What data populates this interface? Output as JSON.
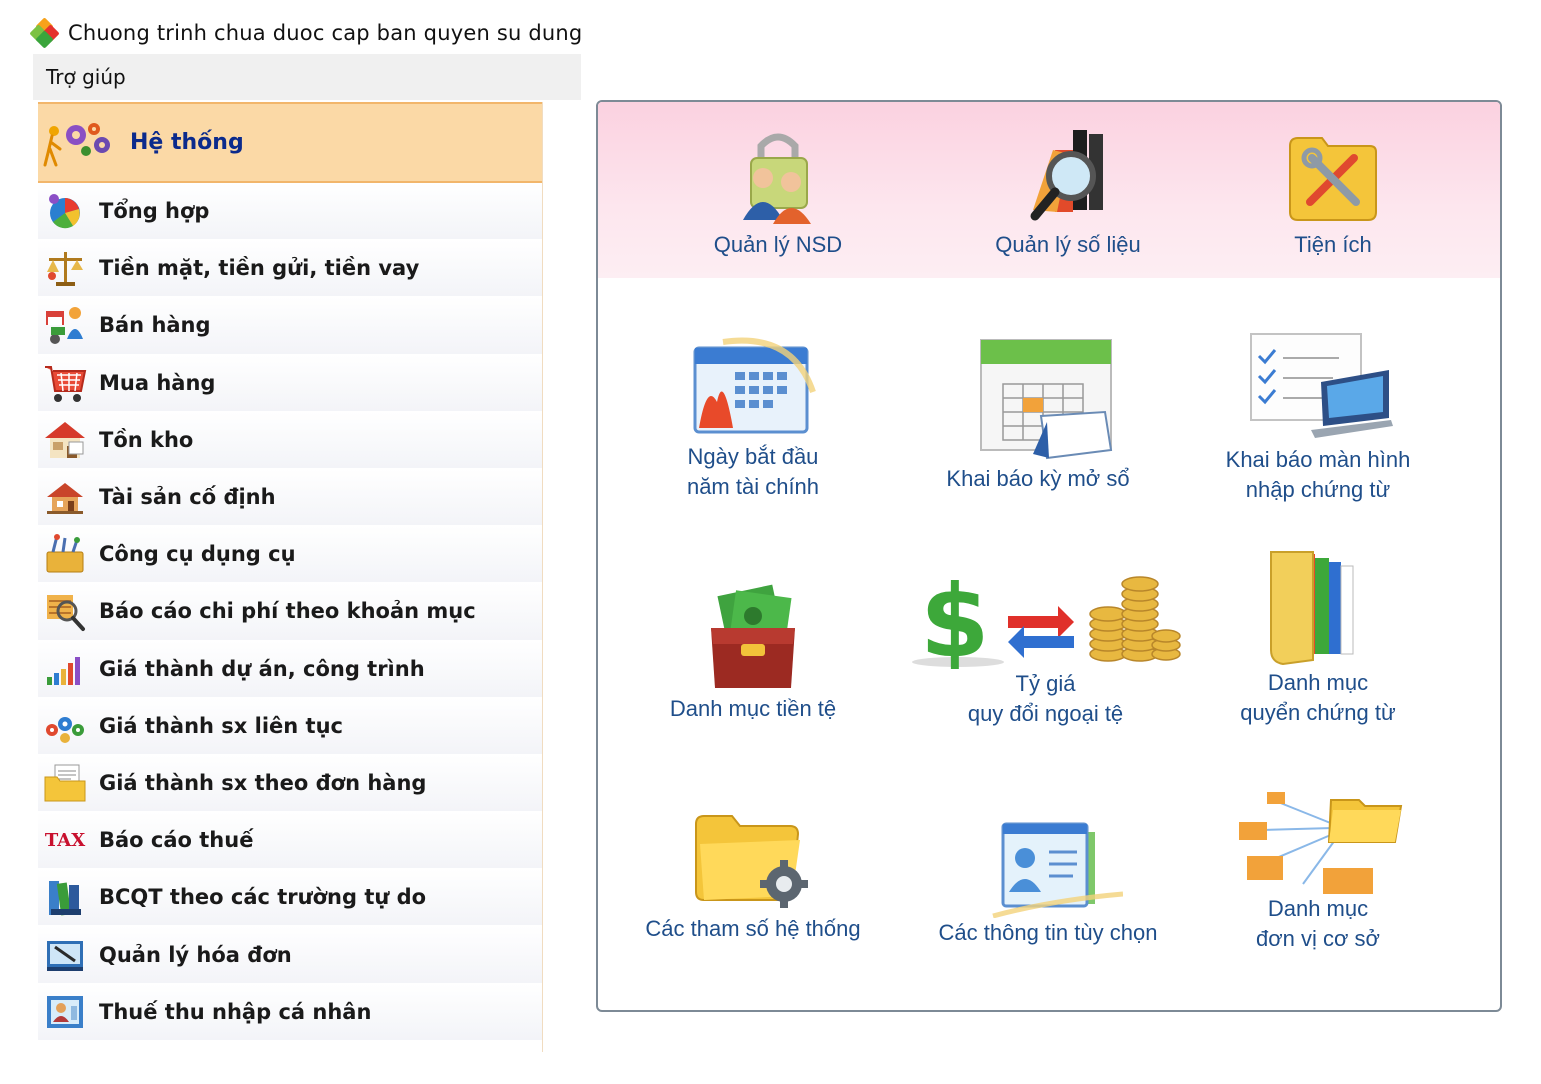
{
  "window": {
    "title": "Chuong trinh chua duoc cap ban quyen su dung"
  },
  "menubar": {
    "items": [
      "Trợ giúp"
    ]
  },
  "sidebar": {
    "header": "Hệ thống",
    "items": [
      {
        "label": "Tổng hợp",
        "icon": "summary-icon"
      },
      {
        "label": "Tiền mặt, tiền gửi, tiền vay",
        "icon": "scale-coins-icon"
      },
      {
        "label": "Bán hàng",
        "icon": "sales-icon"
      },
      {
        "label": "Mua hàng",
        "icon": "shopping-cart-icon"
      },
      {
        "label": "Tồn kho",
        "icon": "warehouse-house-icon"
      },
      {
        "label": "Tài sản cố định",
        "icon": "fixed-asset-house-icon"
      },
      {
        "label": "Công cụ dụng cụ",
        "icon": "tools-box-icon"
      },
      {
        "label": "Báo cáo chi phí theo khoản mục",
        "icon": "magnifier-report-icon"
      },
      {
        "label": "Giá thành dự án, công trình",
        "icon": "bar-chart-icon"
      },
      {
        "label": "Giá thành sx liên tục",
        "icon": "gears-icon"
      },
      {
        "label": "Giá thành sx theo đơn hàng",
        "icon": "folder-document-icon"
      },
      {
        "label": "Báo cáo thuế",
        "icon": "tax-icon",
        "icon_text": "TAX"
      },
      {
        "label": "BCQT theo các trường tự do",
        "icon": "books-icon"
      },
      {
        "label": "Quản lý hóa đơn",
        "icon": "invoice-icon"
      },
      {
        "label": "Thuế thu nhập cá nhân",
        "icon": "person-card-icon"
      }
    ]
  },
  "panel": {
    "top_tiles": [
      {
        "label": "Quản lý NSD",
        "icon": "users-lock-icon"
      },
      {
        "label": "Quản lý số liệu",
        "icon": "data-search-icon"
      },
      {
        "label": "Tiện ích",
        "icon": "utility-tools-icon"
      }
    ],
    "tiles": [
      {
        "label": "Ngày bắt đầu\nnăm tài chính",
        "icon": "fiscal-calendar-icon"
      },
      {
        "label": "Khai báo kỳ mở sổ",
        "icon": "period-calendar-icon"
      },
      {
        "label": "Khai báo màn hình\nnhập chứng từ",
        "icon": "checklist-laptop-icon"
      },
      {
        "label": "Danh mục tiền tệ",
        "icon": "money-wallet-icon"
      },
      {
        "label": "Tỷ giá\nquy đổi ngoại tệ",
        "icon": "exchange-rate-icon"
      },
      {
        "label": "Danh mục\nquyển chứng từ",
        "icon": "document-folder-icon"
      },
      {
        "label": "Các tham số hệ thống",
        "icon": "folder-gear-icon"
      },
      {
        "label": "Các thông tin tùy chọn",
        "icon": "contact-card-icon"
      },
      {
        "label": "Danh mục\nđơn vị cơ sở",
        "icon": "folder-network-icon"
      }
    ]
  },
  "colors": {
    "header_bg": "#fbd9a6",
    "header_text": "#0b2a8c",
    "tile_text": "#1f4e8a",
    "band_pink": "#fbd1e0",
    "tax_red": "#c8102e"
  }
}
